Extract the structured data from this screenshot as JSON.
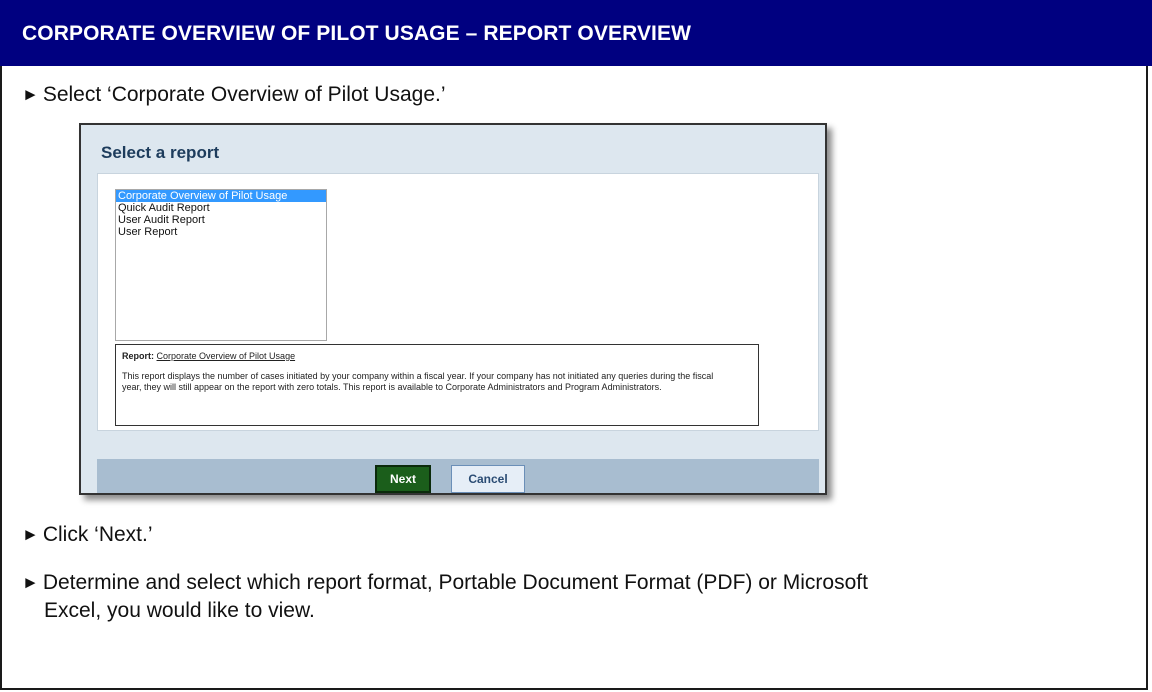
{
  "header": {
    "title": "CORPORATE OVERVIEW OF PILOT USAGE – REPORT OVERVIEW"
  },
  "instructions": [
    {
      "arrow": "►",
      "text": "Select ‘Corporate Overview of Pilot Usage.’"
    },
    {
      "arrow": "►",
      "text": "Click ‘Next.’"
    },
    {
      "arrow": "►",
      "text_line1": "Determine and select which report format, Portable Document Format (PDF) or Microsoft",
      "text_line2": "Excel, you would like to view."
    }
  ],
  "screenshot": {
    "title": "Select a report",
    "report_list": {
      "items": [
        {
          "label": "Corporate Overview of Pilot Usage",
          "selected": true
        },
        {
          "label": "Quick Audit Report",
          "selected": false
        },
        {
          "label": "User Audit Report",
          "selected": false
        },
        {
          "label": "User Report",
          "selected": false
        }
      ]
    },
    "description": {
      "label": "Report:",
      "link": "Corporate Overview of Pilot Usage",
      "text": "This report displays the number of cases initiated by your company within a fiscal year. If your company has not initiated any queries during the fiscal year, they will still appear on the report with zero totals. This report is available to Corporate Administrators and Program Administrators."
    },
    "buttons": {
      "next_label": "Next",
      "cancel_label": "Cancel"
    }
  }
}
